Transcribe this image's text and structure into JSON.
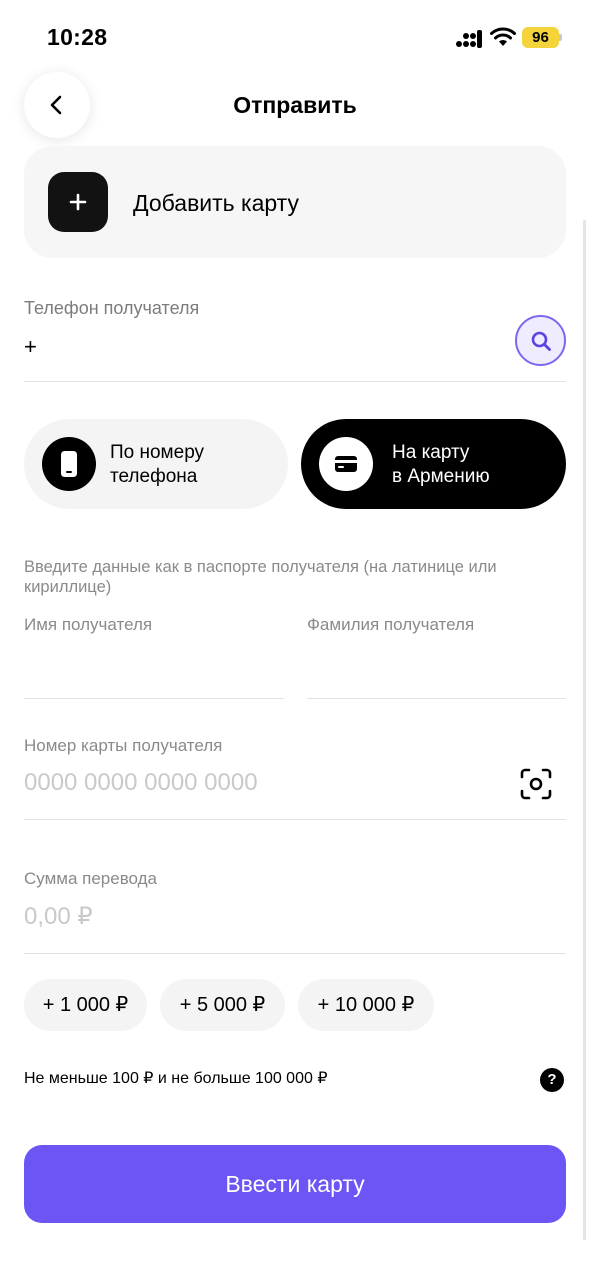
{
  "status_bar": {
    "time": "10:28",
    "battery_level": "96",
    "battery_color": "#f5d33a"
  },
  "header": {
    "title": "Отправить",
    "back_icon": "chevron-left-icon"
  },
  "add_card": {
    "label": "Добавить карту",
    "icon": "plus-icon"
  },
  "phone": {
    "label": "Телефон получателя",
    "value": "+",
    "search_icon": "search-icon"
  },
  "modes": [
    {
      "label_line1": "По номеру",
      "label_line2": "телефона",
      "icon": "phone-icon",
      "selected": false
    },
    {
      "label_line1": "На карту",
      "label_line2": "в Армению",
      "icon": "credit-card-icon",
      "selected": true
    }
  ],
  "hint": "Введите данные как в паспорте получателя (на латинице или кириллице)",
  "first_name": {
    "label": "Имя получателя",
    "value": ""
  },
  "last_name": {
    "label": "Фамилия получателя",
    "value": ""
  },
  "card_number": {
    "label": "Номер карты получателя",
    "placeholder": "0000 0000 0000 0000",
    "scan_icon": "scan-icon"
  },
  "amount": {
    "label": "Сумма перевода",
    "placeholder": "0,00 ₽"
  },
  "chips": [
    "+ 1 000 ₽",
    "+ 5 000 ₽",
    "+ 10 000 ₽"
  ],
  "limit": "Не меньше 100 ₽ и не больше 100 000 ₽",
  "help_icon": "?",
  "submit": "Ввести карту",
  "colors": {
    "accent": "#6b55f5",
    "accent_light": "#efecff",
    "dark": "#000000"
  }
}
